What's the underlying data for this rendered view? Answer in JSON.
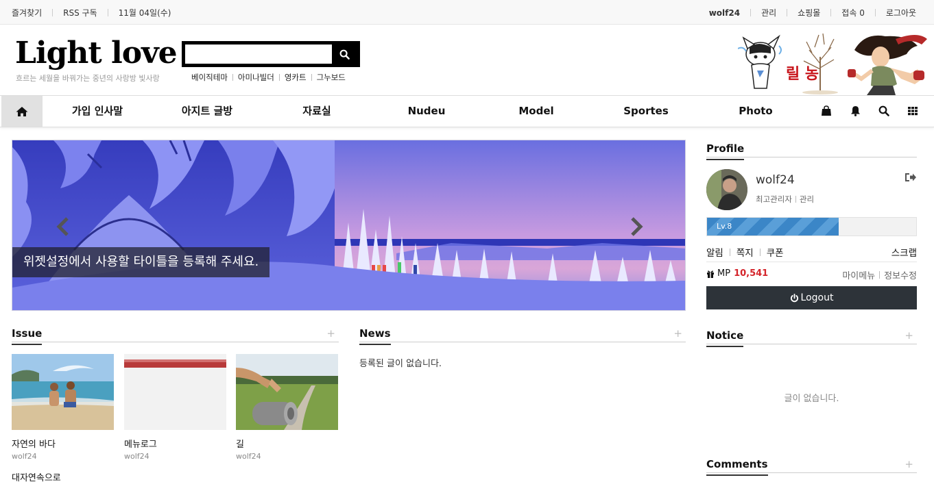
{
  "topbar": {
    "favorites": "즐겨찾기",
    "rss": "RSS 구독",
    "date": "11월 04일(수)",
    "user": "wolf24",
    "admin": "관리",
    "shop": "쇼핑몰",
    "visitors": "접속 0",
    "logout": "로그아웃"
  },
  "header": {
    "logo": "Light love",
    "tagline": "흐르는 세월을 바꿔가는 중년의 사랑방 빛사랑",
    "search_placeholder": "",
    "quick_links": [
      "베이직테마",
      "아미나빌더",
      "영카트",
      "그누보드"
    ],
    "banner_text": "릴 농"
  },
  "nav": {
    "items": [
      "가입 인사말",
      "아지트 글방",
      "자료실",
      "Nudeu",
      "Model",
      "Sportes",
      "Photo"
    ],
    "icons": [
      "home-icon",
      "shopping-bag-icon",
      "bell-icon",
      "search-icon",
      "grid-icon"
    ]
  },
  "slider": {
    "caption": "위젯설정에서 사용할 타이틀을 등록해 주세요."
  },
  "issue": {
    "title": "Issue",
    "plus": "+",
    "items": [
      {
        "title": "자연의 바다",
        "author": "wolf24"
      },
      {
        "title": "메뉴로그",
        "author": "wolf24"
      },
      {
        "title": "길",
        "author": "wolf24"
      }
    ],
    "next_title": "대자연속으로"
  },
  "news": {
    "title": "News",
    "plus": "+",
    "empty": "등록된 글이 없습니다."
  },
  "profile": {
    "title": "Profile",
    "name": "wolf24",
    "role": "최고관리자",
    "admin_link": "관리",
    "level": "Lv.8",
    "level_progress": 0.63,
    "menu": [
      "알림",
      "쪽지",
      "쿠폰"
    ],
    "scrap": "스크랩",
    "mp_label": "MP",
    "mp_value": "10,541",
    "my_menu": "마이메뉴",
    "edit_info": "정보수정",
    "logout_button": "Logout"
  },
  "notice": {
    "title": "Notice",
    "plus": "+",
    "empty": "글이 없습니다."
  },
  "comments": {
    "title": "Comments",
    "plus": "+"
  },
  "colors": {
    "nav_home_bg": "#e1e1e1",
    "logout_bg": "#2d3339",
    "level_bar": "#3b86c7",
    "mp_value": "#d4242a"
  }
}
